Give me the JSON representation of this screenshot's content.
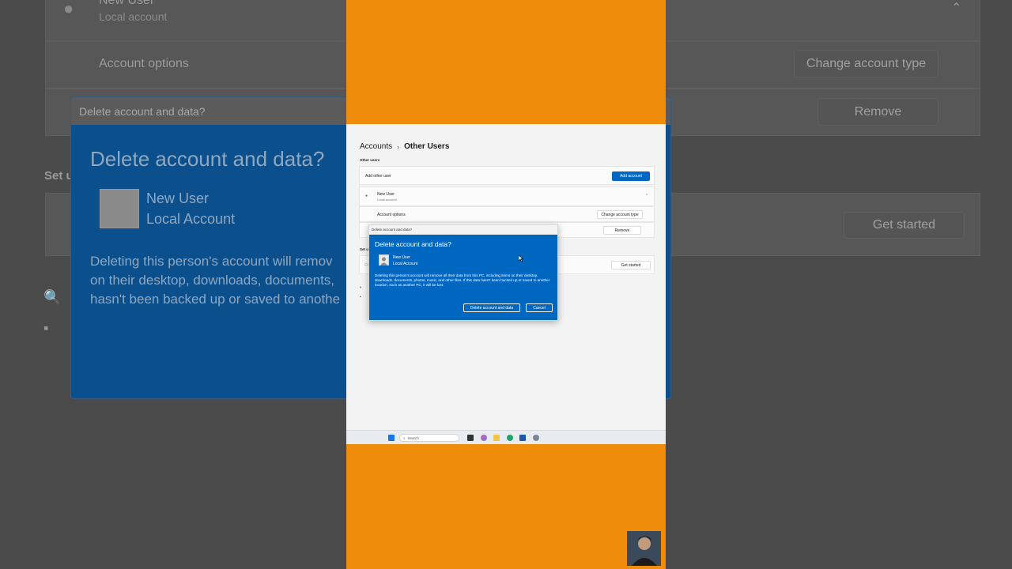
{
  "background": {
    "user_name": "New User",
    "user_type": "Local account",
    "account_options_label": "Account options",
    "change_account_type_label": "Change account type",
    "remove_label": "Remove",
    "set_label": "Set u",
    "get_started_label": "Get started",
    "dialog": {
      "titlebar": "Delete account and data?",
      "title": "Delete account and data?",
      "user_name": "New User",
      "user_type": "Local Account",
      "body_lines": [
        "Deleting this person's account will remov",
        "on their desktop, downloads, documents,",
        "hasn't been backed up or saved to anothe"
      ]
    }
  },
  "screen": {
    "breadcrumb": {
      "parent": "Accounts",
      "separator": "›",
      "current": "Other Users"
    },
    "other_users_heading": "Other users",
    "add_other_user_label": "Add other user",
    "add_account_button": "Add account",
    "user_card": {
      "name": "New User",
      "type": "Local account"
    },
    "account_options_label": "Account options",
    "change_account_type_button": "Change account type",
    "remove_button": "Remove",
    "set_label": "Set u",
    "get_started_button": "Get started",
    "dialog": {
      "titlebar": "Delete account and data?",
      "title": "Delete account and data?",
      "user_name": "New User",
      "user_type": "Local Account",
      "body": "Deleting this person's account will remove all their data from this PC, including items on their desktop, downloads, documents, photos, music, and other files. If this data hasn't been backed up or saved to another location, such as another PC, it will be lost.",
      "confirm_button": "Delete account and data",
      "cancel_button": "Cancel"
    },
    "taskbar": {
      "search_placeholder": "Search"
    }
  },
  "colors": {
    "frame_orange": "#ef8c0c",
    "dialog_blue": "#0067c0",
    "accent": "#0067c0"
  }
}
